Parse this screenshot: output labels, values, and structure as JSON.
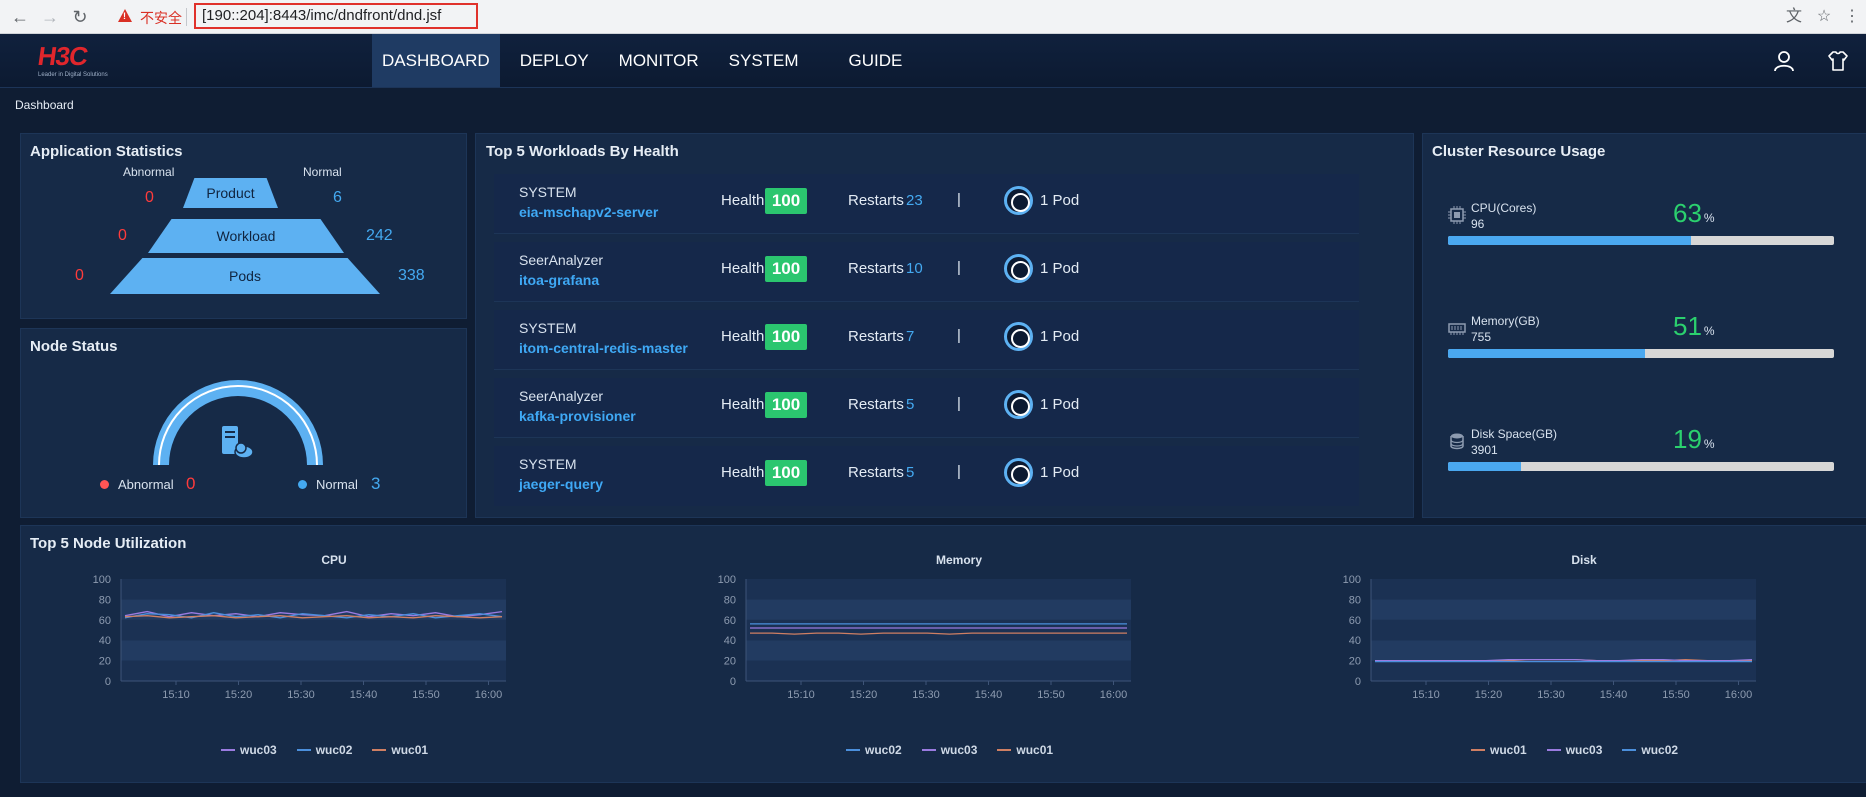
{
  "browser": {
    "insecure_label": "不安全",
    "url": "[190::204]:8443/imc/dndfront/dnd.jsf"
  },
  "app": {
    "logo_text": "H3C",
    "logo_tagline": "Leader in Digital Solutions",
    "menu": [
      {
        "label": "DASHBOARD",
        "active": true
      },
      {
        "label": "DEPLOY",
        "active": false
      },
      {
        "label": "MONITOR",
        "active": false
      },
      {
        "label": "SYSTEM",
        "active": false
      },
      {
        "label": "GUIDE",
        "active": false
      }
    ],
    "icons": [
      "user-icon",
      "skin-icon"
    ],
    "breadcrumb": "Dashboard"
  },
  "app_stats": {
    "title": "Application Statistics",
    "abnormal_label": "Abnormal",
    "normal_label": "Normal",
    "rows": [
      {
        "label": "Product",
        "abnormal": "0",
        "normal": "6"
      },
      {
        "label": "Workload",
        "abnormal": "0",
        "normal": "242"
      },
      {
        "label": "Pods",
        "abnormal": "0",
        "normal": "338"
      }
    ]
  },
  "node_status": {
    "title": "Node Status",
    "abnormal_label": "Abnormal",
    "abnormal_value": "0",
    "normal_label": "Normal",
    "normal_value": "3"
  },
  "workloads": {
    "title": "Top 5 Workloads By Health",
    "health_label": "Health",
    "restarts_label": "Restarts",
    "divider": "|",
    "items": [
      {
        "namespace": "SYSTEM",
        "name": "eia-mschapv2-server",
        "health": "100",
        "restarts": "23",
        "pods": "1 Pod"
      },
      {
        "namespace": "SeerAnalyzer",
        "name": "itoa-grafana",
        "health": "100",
        "restarts": "10",
        "pods": "1 Pod"
      },
      {
        "namespace": "SYSTEM",
        "name": "itom-central-redis-master",
        "health": "100",
        "restarts": "7",
        "pods": "1 Pod"
      },
      {
        "namespace": "SeerAnalyzer",
        "name": "kafka-provisioner",
        "health": "100",
        "restarts": "5",
        "pods": "1 Pod"
      },
      {
        "namespace": "SYSTEM",
        "name": "jaeger-query",
        "health": "100",
        "restarts": "5",
        "pods": "1 Pod"
      }
    ]
  },
  "cluster": {
    "title": "Cluster Resource Usage",
    "percent_sign": "%",
    "resources": [
      {
        "name": "CPU(Cores)",
        "total": "96",
        "percent": "63",
        "fraction": 0.63,
        "icon": "cpu-icon"
      },
      {
        "name": "Memory(GB)",
        "total": "755",
        "percent": "51",
        "fraction": 0.51,
        "icon": "memory-icon"
      },
      {
        "name": "Disk Space(GB)",
        "total": "3901",
        "percent": "19",
        "fraction": 0.19,
        "icon": "disk-icon"
      }
    ]
  },
  "node_util": {
    "title": "Top 5 Node Utilization"
  },
  "colors": {
    "wuc01": "#cf7f63",
    "wuc02": "#4b8fdc",
    "wuc03": "#9a7be0",
    "accent": "#5db1f2",
    "health_green": "#2bc66f",
    "abnormal_red": "#ff3b3b"
  },
  "chart_data": [
    {
      "type": "line",
      "title": "CPU",
      "x": [
        "15:10",
        "15:20",
        "15:30",
        "15:40",
        "15:50",
        "16:00"
      ],
      "ylim": [
        0,
        100
      ],
      "yticks": [
        0,
        20,
        40,
        60,
        80,
        100
      ],
      "series": [
        {
          "name": "wuc03",
          "values": [
            64,
            68,
            63,
            67,
            64,
            66,
            63,
            67,
            65,
            64,
            68,
            63,
            66,
            64,
            67,
            63,
            65,
            68
          ]
        },
        {
          "name": "wuc02",
          "values": [
            62,
            66,
            65,
            62,
            67,
            63,
            65,
            62,
            66,
            64,
            62,
            65,
            63,
            66,
            62,
            64,
            66,
            63
          ]
        },
        {
          "name": "wuc01",
          "values": [
            63,
            64,
            62,
            63,
            64,
            62,
            63,
            64,
            62,
            63,
            64,
            62,
            63,
            62,
            64,
            63,
            62,
            63
          ]
        }
      ]
    },
    {
      "type": "line",
      "title": "Memory",
      "x": [
        "15:10",
        "15:20",
        "15:30",
        "15:40",
        "15:50",
        "16:00"
      ],
      "ylim": [
        0,
        100
      ],
      "yticks": [
        0,
        20,
        40,
        60,
        80,
        100
      ],
      "series": [
        {
          "name": "wuc02",
          "values": [
            56,
            56,
            56,
            56,
            56,
            56,
            56,
            56,
            56,
            56,
            56,
            56,
            56,
            56,
            56,
            56,
            56,
            56
          ]
        },
        {
          "name": "wuc03",
          "values": [
            52,
            52,
            52,
            52,
            52,
            52,
            52,
            52,
            52,
            52,
            52,
            52,
            52,
            52,
            52,
            52,
            52,
            52
          ]
        },
        {
          "name": "wuc01",
          "values": [
            47,
            47,
            46,
            47,
            47,
            46,
            47,
            47,
            47,
            46,
            47,
            47,
            47,
            47,
            47,
            47,
            47,
            47
          ]
        }
      ]
    },
    {
      "type": "line",
      "title": "Disk",
      "x": [
        "15:10",
        "15:20",
        "15:30",
        "15:40",
        "15:50",
        "16:00"
      ],
      "ylim": [
        0,
        100
      ],
      "yticks": [
        0,
        20,
        40,
        60,
        80,
        100
      ],
      "series": [
        {
          "name": "wuc01",
          "values": [
            20,
            20,
            20,
            20,
            20,
            20,
            20,
            21,
            21,
            21,
            20,
            20,
            20,
            20,
            21,
            20,
            20,
            20
          ]
        },
        {
          "name": "wuc03",
          "values": [
            20,
            20,
            20,
            20,
            20,
            20,
            21,
            21,
            21,
            21,
            20,
            20,
            21,
            21,
            20,
            20,
            20,
            21
          ]
        },
        {
          "name": "wuc02",
          "values": [
            19,
            19,
            19,
            19,
            19,
            19,
            19,
            19,
            19,
            19,
            19,
            19,
            19,
            19,
            19,
            19,
            19,
            19
          ]
        }
      ]
    }
  ]
}
